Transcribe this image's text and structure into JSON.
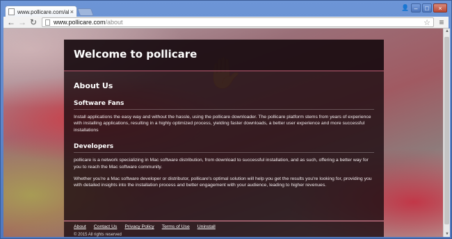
{
  "browser": {
    "tab_title": "www.pollicare.com/about",
    "tab_close": "×",
    "url_host": "www.pollicare.com",
    "url_path": "/about",
    "back_icon": "←",
    "forward_icon": "→",
    "reload_icon": "↻",
    "star_icon": "☆",
    "menu_icon": "≡",
    "win_minimize": "–",
    "win_maximize": "□",
    "win_close": "×",
    "user_icon": "👤"
  },
  "page": {
    "site_title": "Welcome to pollicare",
    "about_heading": "About Us",
    "sections": [
      {
        "heading": "Software Fans",
        "paragraphs": [
          "Install applications the easy way and without the hassle, using the pollicare downloader. The pollicare platform stems from years of experience with installing applications, resulting in a highly optimized process, yielding faster downloads, a better user experience and more successful installations"
        ]
      },
      {
        "heading": "Developers",
        "paragraphs": [
          "pollicare is a network specializing in Mac software distribution, from download to successful installation, and as such, offering a better way for you to reach the Mac software community.",
          "Whether you're a Mac software developer or distributor, pollicare's optimal solution will help you get the results you're looking for, providing you with detailed insights into the installation process and better engagement with your audience, leading to higher revenues."
        ]
      }
    ],
    "footer_links": [
      "About",
      "Contact Us",
      "Privacy Policy",
      "Terms of Use",
      "Uninstall"
    ],
    "copyright": "© 2015 All rights reserved"
  }
}
